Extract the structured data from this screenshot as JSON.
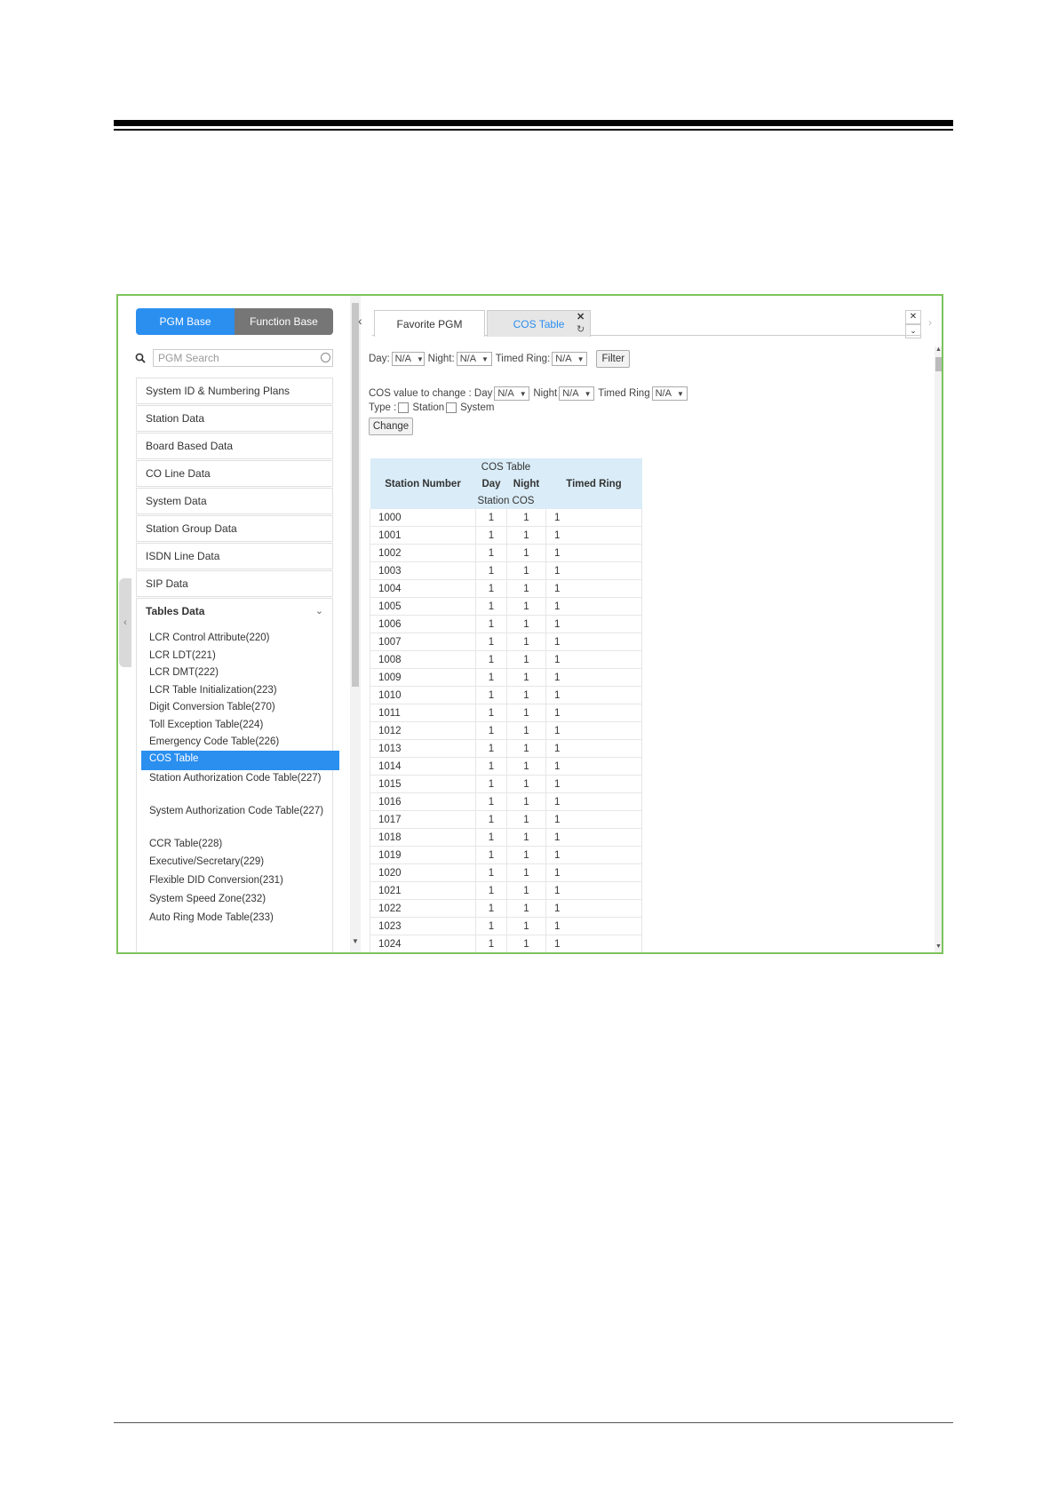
{
  "sidebar": {
    "pgm_base": "PGM Base",
    "function_base": "Function Base",
    "search_placeholder": "PGM Search",
    "menu": [
      "System ID & Numbering Plans",
      "Station Data",
      "Board Based Data",
      "CO Line Data",
      "System Data",
      "Station Group Data",
      "ISDN Line Data",
      "SIP Data",
      "Tables Data"
    ],
    "tables_sub": [
      "LCR Control Attribute(220)",
      "LCR LDT(221)",
      "LCR DMT(222)",
      "LCR Table Initialization(223)",
      "Digit Conversion Table(270)",
      "Toll Exception Table(224)",
      "Emergency Code Table(226)",
      "COS Table",
      "Station Authorization Code Table(227)",
      "System Authorization Code Table(227)",
      "CCR Table(228)",
      "Executive/Secretary(229)",
      "Flexible DID Conversion(231)",
      "System Speed Zone(232)",
      "Auto Ring Mode Table(233)"
    ]
  },
  "tabs": {
    "favorite": "Favorite PGM",
    "cos": "COS Table"
  },
  "filter": {
    "day_label": "Day:",
    "night_label": "Night:",
    "timed_label": "Timed Ring:",
    "value": "N/A",
    "button": "Filter"
  },
  "change": {
    "label": "COS value to change : Day",
    "night_label": "Night",
    "timed_label": "Timed Ring",
    "value": "N/A",
    "type_label": "Type :",
    "station": "Station",
    "system": "System",
    "button": "Change"
  },
  "table": {
    "title": "COS Table",
    "col_station": "Station Number",
    "col_day": "Day",
    "col_night": "Night",
    "col_timed": "Timed Ring",
    "sub_header": "Station COS",
    "rows": [
      [
        "1000",
        "1",
        "1",
        "1"
      ],
      [
        "1001",
        "1",
        "1",
        "1"
      ],
      [
        "1002",
        "1",
        "1",
        "1"
      ],
      [
        "1003",
        "1",
        "1",
        "1"
      ],
      [
        "1004",
        "1",
        "1",
        "1"
      ],
      [
        "1005",
        "1",
        "1",
        "1"
      ],
      [
        "1006",
        "1",
        "1",
        "1"
      ],
      [
        "1007",
        "1",
        "1",
        "1"
      ],
      [
        "1008",
        "1",
        "1",
        "1"
      ],
      [
        "1009",
        "1",
        "1",
        "1"
      ],
      [
        "1010",
        "1",
        "1",
        "1"
      ],
      [
        "1011",
        "1",
        "1",
        "1"
      ],
      [
        "1012",
        "1",
        "1",
        "1"
      ],
      [
        "1013",
        "1",
        "1",
        "1"
      ],
      [
        "1014",
        "1",
        "1",
        "1"
      ],
      [
        "1015",
        "1",
        "1",
        "1"
      ],
      [
        "1016",
        "1",
        "1",
        "1"
      ],
      [
        "1017",
        "1",
        "1",
        "1"
      ],
      [
        "1018",
        "1",
        "1",
        "1"
      ],
      [
        "1019",
        "1",
        "1",
        "1"
      ],
      [
        "1020",
        "1",
        "1",
        "1"
      ],
      [
        "1021",
        "1",
        "1",
        "1"
      ],
      [
        "1022",
        "1",
        "1",
        "1"
      ],
      [
        "1023",
        "1",
        "1",
        "1"
      ],
      [
        "1024",
        "1",
        "1",
        "1"
      ]
    ]
  },
  "colors": {
    "accent": "#2b8ff0",
    "frame": "#7cc45c",
    "table_header": "#d9ecf7"
  }
}
